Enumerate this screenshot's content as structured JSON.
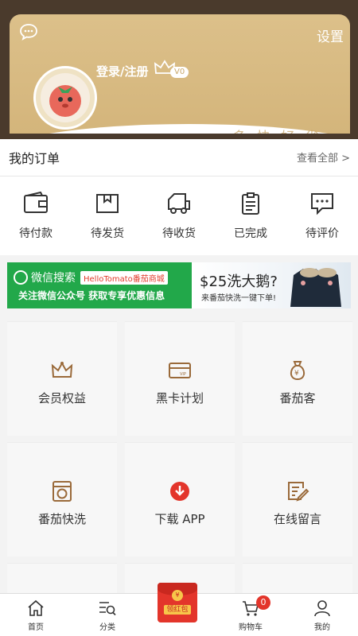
{
  "header": {
    "settings_label": "设置",
    "login_label": "登录/注册",
    "vip_level": "V0",
    "slogan": "·多·快·好·省·"
  },
  "orders": {
    "title": "我的订单",
    "view_all": "查看全部 >",
    "items": [
      {
        "label": "待付款",
        "icon": "wallet-icon"
      },
      {
        "label": "待发货",
        "icon": "box-icon"
      },
      {
        "label": "待收货",
        "icon": "truck-icon"
      },
      {
        "label": "已完成",
        "icon": "clipboard-icon"
      },
      {
        "label": "待评价",
        "icon": "comment-icon"
      }
    ]
  },
  "banner": {
    "search_label": "微信搜索",
    "search_tag": "HelloTomato番茄商城",
    "follow_text": "关注微信公众号 获取专享优惠信息",
    "promo_title": "$25洗大鹅?",
    "promo_sub": "来番茄快洗一键下单!"
  },
  "grid": [
    {
      "label": "会员权益",
      "icon": "crown-icon"
    },
    {
      "label": "黑卡计划",
      "icon": "vip-card-icon"
    },
    {
      "label": "番茄客",
      "icon": "money-bag-icon"
    },
    {
      "label": "番茄快洗",
      "icon": "washing-machine-icon"
    },
    {
      "label": "下载 APP",
      "icon": "download-icon"
    },
    {
      "label": "在线留言",
      "icon": "edit-note-icon"
    }
  ],
  "tabbar": {
    "home": "首页",
    "category": "分类",
    "red_packet": "领红包",
    "cart": "购物车",
    "cart_count": "0",
    "mine": "我的"
  },
  "colors": {
    "header_gold": "#d4b57b",
    "header_dark": "#4a3a2c",
    "accent_brown": "#9a6a3a",
    "wechat_green": "#22a84a",
    "red": "#e3352b"
  }
}
